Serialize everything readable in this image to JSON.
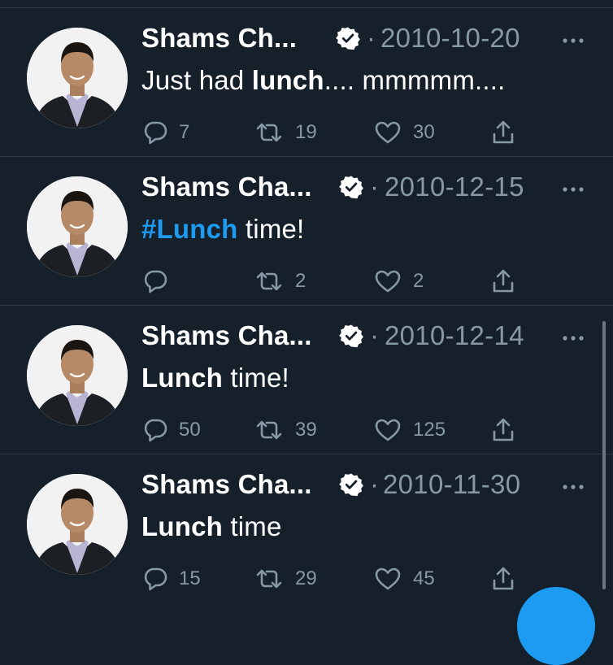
{
  "colors": {
    "background": "#15202b",
    "secondary_text": "#8899a6",
    "accent": "#1d9bf0",
    "divider": "#2f3c4a"
  },
  "tweets": [
    {
      "author": "Shams Ch...",
      "separator": "·",
      "date": "2010-10-20",
      "text_parts": [
        {
          "t": "Just had "
        },
        {
          "b": "lunch"
        },
        {
          "t": ".... mmmmm...."
        }
      ],
      "replies": "7",
      "retweets": "19",
      "likes": "30"
    },
    {
      "author": "Shams Cha...",
      "separator": "·",
      "date": "2010-12-15",
      "text_parts": [
        {
          "tag": "#Lunch"
        },
        {
          "t": " time!"
        }
      ],
      "replies": "",
      "retweets": "2",
      "likes": "2"
    },
    {
      "author": "Shams Cha...",
      "separator": "·",
      "date": "2010-12-14",
      "text_parts": [
        {
          "b": "Lunch"
        },
        {
          "t": " time!"
        }
      ],
      "replies": "50",
      "retweets": "39",
      "likes": "125"
    },
    {
      "author": "Shams Cha...",
      "separator": "·",
      "date": "2010-11-30",
      "text_parts": [
        {
          "b": "Lunch"
        },
        {
          "t": " time"
        }
      ],
      "replies": "15",
      "retweets": "29",
      "likes": "45"
    }
  ],
  "icons": {
    "verified": "verified-badge-icon",
    "more": "more-options-icon",
    "reply": "reply-icon",
    "retweet": "retweet-icon",
    "like": "heart-icon",
    "share": "share-icon"
  }
}
